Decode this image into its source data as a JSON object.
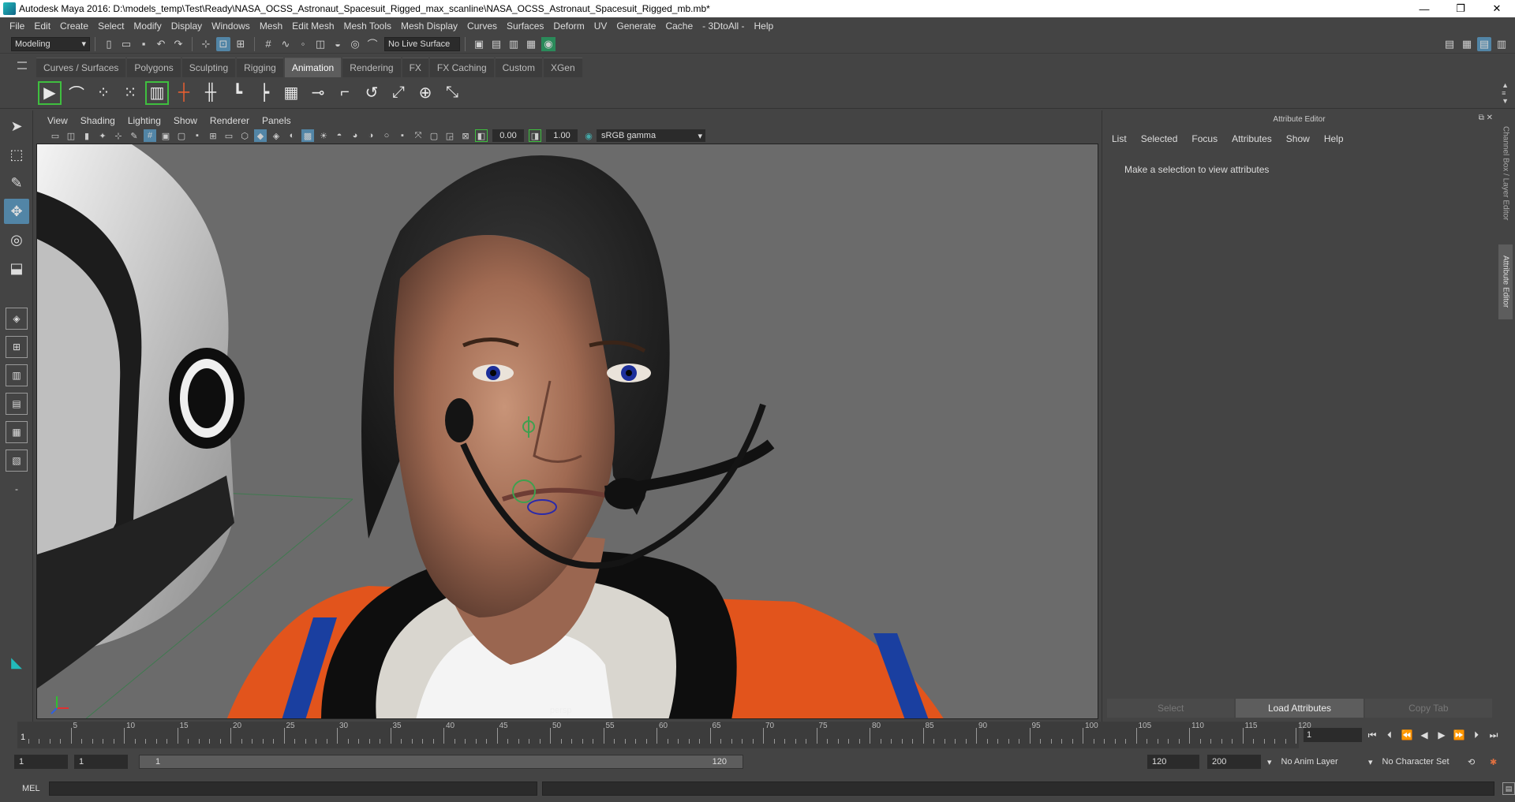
{
  "window": {
    "title": "Autodesk Maya 2016: D:\\models_temp\\Test\\Ready\\NASA_OCSS_Astronaut_Spacesuit_Rigged_max_scanline\\NASA_OCSS_Astronaut_Spacesuit_Rigged_mb.mb*",
    "minimize": "—",
    "restore": "❐",
    "close": "✕"
  },
  "menubar": [
    "File",
    "Edit",
    "Create",
    "Select",
    "Modify",
    "Display",
    "Windows",
    "Mesh",
    "Edit Mesh",
    "Mesh Tools",
    "Mesh Display",
    "Curves",
    "Surfaces",
    "Deform",
    "UV",
    "Generate",
    "Cache",
    "- 3DtoAll -",
    "Help"
  ],
  "statusline": {
    "menuset": "Modeling",
    "live_surface": "No Live Surface"
  },
  "shelf": {
    "tabs": [
      "Curves / Surfaces",
      "Polygons",
      "Sculpting",
      "Rigging",
      "Animation",
      "Rendering",
      "FX",
      "FX Caching",
      "Custom",
      "XGen"
    ],
    "active_tab": "Animation"
  },
  "viewport": {
    "menu": [
      "View",
      "Shading",
      "Lighting",
      "Show",
      "Renderer",
      "Panels"
    ],
    "exposure": "0.00",
    "gamma": "1.00",
    "color_space": "sRGB gamma",
    "camera": "persp"
  },
  "attribute_editor": {
    "header": "Attribute Editor",
    "menu": [
      "List",
      "Selected",
      "Focus",
      "Attributes",
      "Show",
      "Help"
    ],
    "message": "Make a selection to view attributes",
    "buttons": {
      "select": "Select",
      "load": "Load Attributes",
      "copy": "Copy Tab"
    }
  },
  "dock_tabs": {
    "channel_box": "Channel Box / Layer Editor",
    "attribute_editor": "Attribute Editor"
  },
  "timeline": {
    "labels": [
      "5",
      "10",
      "15",
      "20",
      "25",
      "30",
      "35",
      "40",
      "45",
      "50",
      "55",
      "60",
      "65",
      "70",
      "75",
      "80",
      "85",
      "90",
      "95",
      "100",
      "105",
      "110",
      "115",
      "120"
    ],
    "current_frame": "1",
    "current_frame_field": "1"
  },
  "range": {
    "start": "1",
    "playback_start": "1",
    "slider_start": "1",
    "slider_end": "120",
    "playback_end": "120",
    "end": "200",
    "anim_layer": "No Anim Layer",
    "character_set": "No Character Set"
  },
  "cmdline": {
    "label": "MEL"
  }
}
